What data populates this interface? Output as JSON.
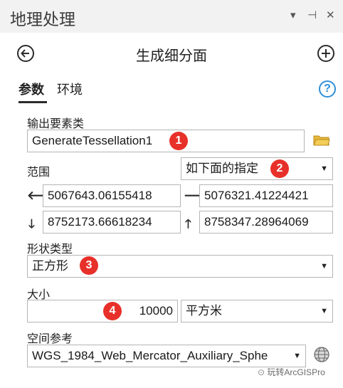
{
  "panel": {
    "title": "地理处理"
  },
  "window_controls": {
    "menu": "▾",
    "pin": "⊣",
    "close": "✕"
  },
  "tool": {
    "title": "生成细分面"
  },
  "tabs": [
    {
      "label": "参数",
      "active": true
    },
    {
      "label": "环境",
      "active": false
    }
  ],
  "fields": {
    "output": {
      "label": "输出要素类",
      "value": "GenerateTessellation1"
    },
    "extent": {
      "label": "范围",
      "dropdown_value": "如下面的指定",
      "left": "5067643.06155418",
      "right": "5076321.41224421",
      "bottom": "8752173.66618234",
      "top": "8758347.28964069"
    },
    "shape_type": {
      "label": "形状类型",
      "value": "正方形"
    },
    "size": {
      "label": "大小",
      "value": "10000",
      "unit": "平方米"
    },
    "spatial_reference": {
      "label": "空间参考",
      "value": "WGS_1984_Web_Mercator_Auxiliary_Sphe"
    }
  },
  "badges": [
    "1",
    "2",
    "3",
    "4"
  ],
  "watermark": "玩转ArcGISPro",
  "colors": {
    "badge": "#e8302a",
    "help": "#2f8fd8",
    "folder": "#e8b83a"
  }
}
